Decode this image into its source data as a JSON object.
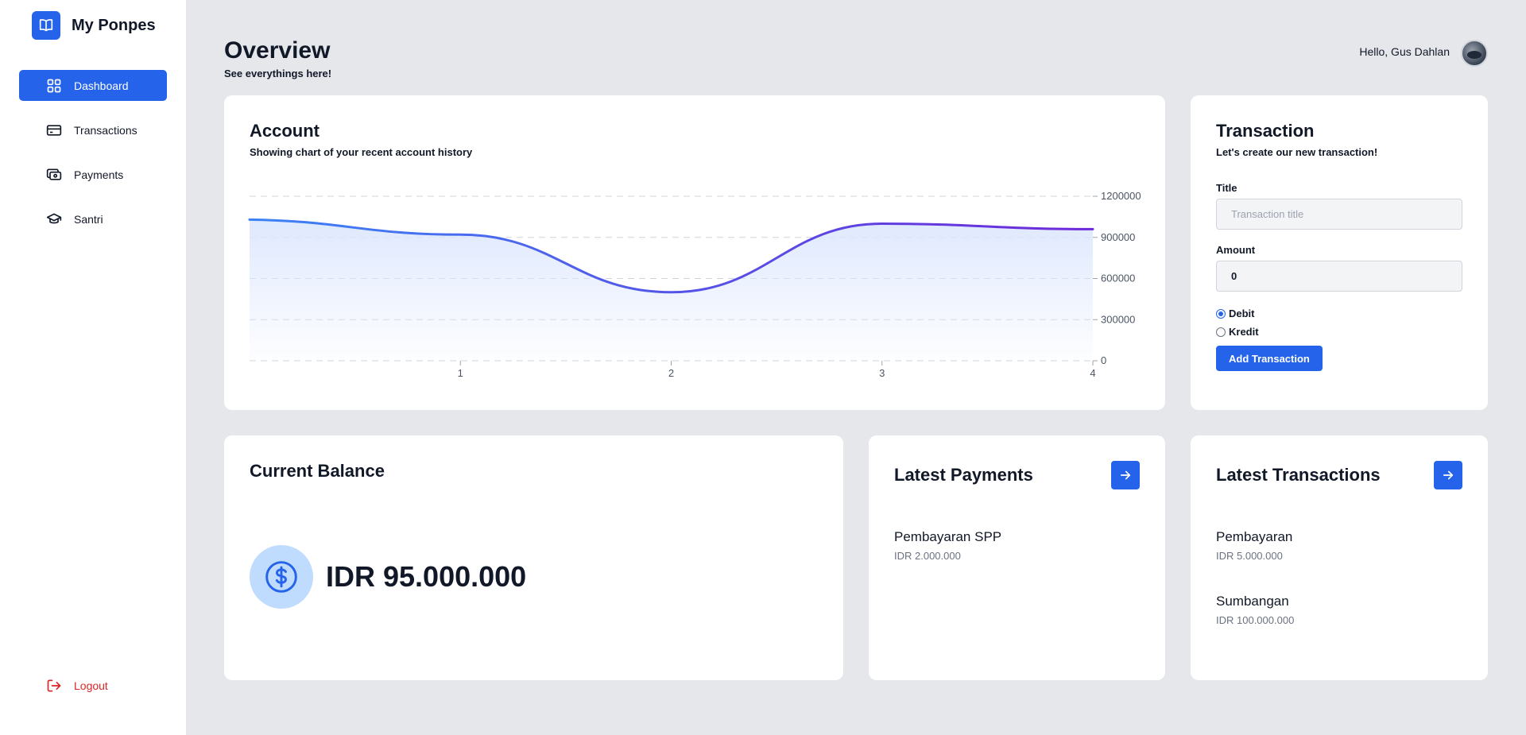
{
  "brand": {
    "name": "My Ponpes"
  },
  "sidebar": {
    "items": [
      {
        "label": "Dashboard",
        "icon": "dashboard-grid-icon",
        "active": true
      },
      {
        "label": "Transactions",
        "icon": "credit-card-icon",
        "active": false
      },
      {
        "label": "Payments",
        "icon": "payment-cash-icon",
        "active": false
      },
      {
        "label": "Santri",
        "icon": "graduation-cap-icon",
        "active": false
      }
    ],
    "logout_label": "Logout"
  },
  "header": {
    "title": "Overview",
    "subtitle": "See everythings here!",
    "greeting": "Hello, Gus Dahlan"
  },
  "account": {
    "title": "Account",
    "subtitle": "Showing chart of your recent account history"
  },
  "chart_data": {
    "type": "area",
    "x": [
      0,
      1,
      2,
      3,
      4
    ],
    "values": [
      1030000,
      920000,
      500000,
      1000000,
      960000
    ],
    "xticks": [
      "1",
      "2",
      "3",
      "4"
    ],
    "yticks": [
      "0",
      "300000",
      "600000",
      "900000",
      "1200000"
    ],
    "ylim": [
      0,
      1200000
    ],
    "xlim": [
      0,
      4
    ],
    "grid": true,
    "colors": {
      "line_start": "#3b82f6",
      "line_end": "#6d28d9",
      "fill": "#dbe6fd"
    }
  },
  "transaction_form": {
    "title": "Transaction",
    "subtitle": "Let's create our new transaction!",
    "title_label": "Title",
    "title_placeholder": "Transaction title",
    "title_value": "",
    "amount_label": "Amount",
    "amount_value": "0",
    "type_options": [
      "Debit",
      "Kredit"
    ],
    "type_selected": "Debit",
    "submit_label": "Add Transaction"
  },
  "balance": {
    "title": "Current Balance",
    "amount": "IDR 95.000.000",
    "icon": "dollar-circle-icon"
  },
  "latest_payments": {
    "title": "Latest Payments",
    "items": [
      {
        "name": "Pembayaran SPP",
        "amount": "IDR 2.000.000"
      }
    ]
  },
  "latest_transactions": {
    "title": "Latest Transactions",
    "items": [
      {
        "name": "Pembayaran",
        "amount": "IDR 5.000.000"
      },
      {
        "name": "Sumbangan",
        "amount": "IDR 100.000.000"
      }
    ]
  },
  "colors": {
    "accent": "#2563eb",
    "danger": "#dc2626",
    "page_bg": "#e5e7eb"
  }
}
